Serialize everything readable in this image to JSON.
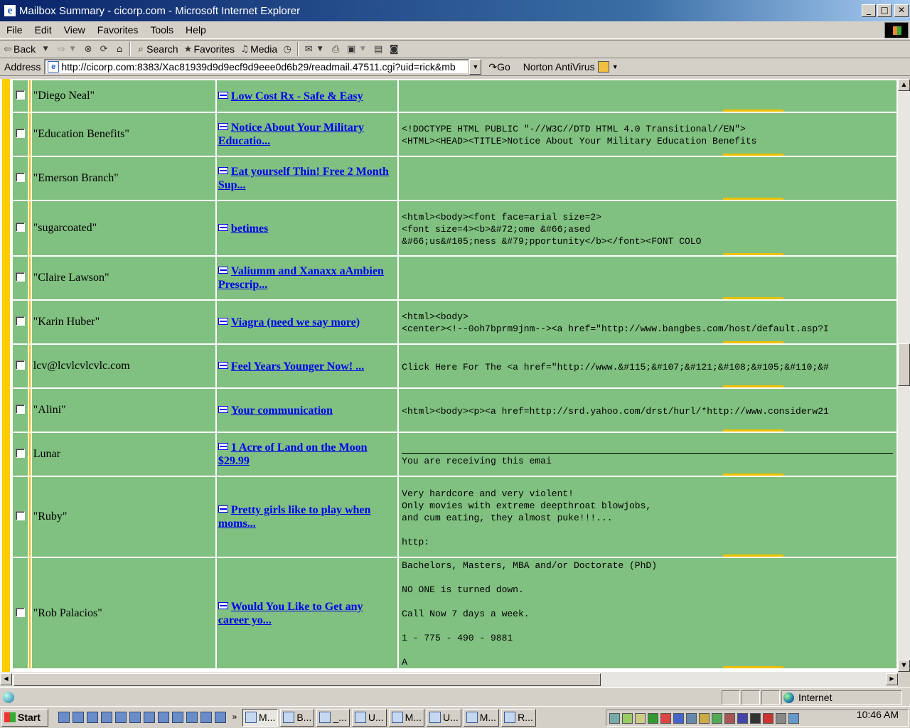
{
  "window": {
    "title": "Mailbox Summary - cicorp.com - Microsoft Internet Explorer",
    "controls": [
      "minimize",
      "maximize",
      "close"
    ]
  },
  "menu": [
    "File",
    "Edit",
    "View",
    "Favorites",
    "Tools",
    "Help"
  ],
  "toolbar": {
    "back_label": "Back",
    "search_label": "Search",
    "favorites_label": "Favorites",
    "media_label": "Media"
  },
  "address": {
    "label": "Address",
    "url": "http://cicorp.com:8383/Xac81939d9d9ecf9d9eee0d6b29/readmail.47511.cgi?uid=rick&mb",
    "go_label": "Go",
    "norton_label": "Norton AntiVirus"
  },
  "messages": [
    {
      "from": "\"Diego Neal\"",
      "subject": "Low Cost Rx - Safe & Easy",
      "body": "",
      "checked": false
    },
    {
      "from": "\"Education Benefits\"",
      "subject": "Notice About Your Military Educatio...",
      "body": "<!DOCTYPE HTML PUBLIC \"-//W3C//DTD HTML 4.0 Transitional//EN\">\n<HTML><HEAD><TITLE>Notice About Your Military Education Benefits",
      "checked": false
    },
    {
      "from": "\"Emerson Branch\"",
      "subject": "Eat yourself Thin! Free 2 Month Sup...",
      "body": "",
      "checked": false
    },
    {
      "from": "\"sugarcoated\"",
      "subject": "betimes",
      "body": "<html><body><font face=arial size=2>\n<font size=4><b>&#72;ome &#66;ased\n&#66;us&#105;ness &#79;pportunity</b></font><FONT COLO",
      "checked": false
    },
    {
      "from": "\"Claire Lawson\"",
      "subject": "Valiumm and Xanaxx aAmbien Prescrip...",
      "body": "",
      "checked": false
    },
    {
      "from": "\"Karin Huber\"",
      "subject": "Viagra (need we say more)",
      "body": "<html><body>\n<center><!--0oh7bprm9jnm--><a href=\"http://www.bangbes.com/host/default.asp?I",
      "checked": false
    },
    {
      "from": "lcv@lcvlcvlcvlc.com",
      "subject": "Feel Years Younger Now!          ...",
      "body": "Click Here For The <a href=\"http://www.&#115;&#107;&#121;&#108;&#105;&#110;&#",
      "checked": false
    },
    {
      "from": "\"Alini\"",
      "subject": "Your communication",
      "body": "<html><body><p><a href=http://srd.yahoo.com/drst/hurl/*http://www.considerw21",
      "checked": false
    },
    {
      "from": "Lunar",
      "subject": "1 Acre of Land on the Moon $29.99",
      "body": "You are receiving this emai",
      "checked": false
    },
    {
      "from": "\"Ruby\"",
      "subject": "Pretty girls like to play when moms...",
      "body": "Very hardcore and very violent!\nOnly movies with extreme deepthroat blowjobs,\nand cum eating, they almost puke!!!...\n\nhttp:",
      "checked": false
    },
    {
      "from": "\"Rob Palacios\"",
      "subject": "Would You Like to Get any career yo...",
      "body": "Bachelors, Masters, MBA and/or Doctorate (PhD)\n\nNO ONE is turned down.\n\nCall Now 7 days a week.\n\n1 - 775 - 490 - 9881\n\nA",
      "checked": false
    }
  ],
  "status": {
    "zone_label": "Internet"
  },
  "taskbar": {
    "start_label": "Start",
    "tasks": [
      "M...",
      "B...",
      "_...",
      "U...",
      "M...",
      "U...",
      "M...",
      "R..."
    ],
    "clock": "10:46 AM"
  }
}
